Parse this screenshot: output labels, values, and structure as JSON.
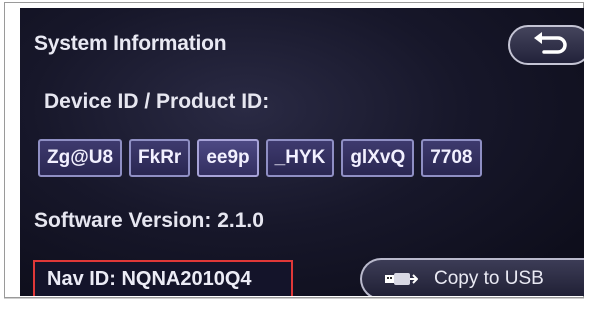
{
  "screen": {
    "title": "System Information",
    "device_label": "Device ID / Product ID:",
    "id_parts": [
      "Zg@U8",
      "FkRr",
      "ee9p",
      "_HYK",
      "glXvQ",
      "7708"
    ],
    "software_version": "Software Version: 2.1.0",
    "nav_id": "Nav ID: NQNA2010Q4",
    "copy_button_label": "Copy to USB",
    "back_icon": "back-arrow-icon",
    "usb_icon": "usb-icon",
    "highlight_color": "#e03838"
  }
}
